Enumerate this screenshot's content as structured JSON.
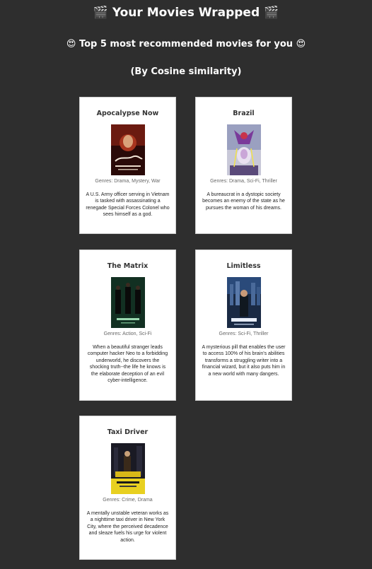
{
  "header": {
    "title": "🎬 Your Movies Wrapped 🎬",
    "subtitle": "😍 Top 5 most recommended movies for you 😍",
    "method": "(By Cosine similarity)"
  },
  "movies": [
    {
      "title": "Apocalypse Now",
      "genres": "Genres: Drama, Mystery, War",
      "description": "A U.S. Army officer serving in Vietnam is tasked with assassinating a renegade Special Forces Colonel who sees himself as a god."
    },
    {
      "title": "Brazil",
      "genres": "Genres: Drama, Sci-Fi, Thriller",
      "description": "A bureaucrat in a dystopic society becomes an enemy of the state as he pursues the woman of his dreams."
    },
    {
      "title": "The Matrix",
      "genres": "Genres: Action, Sci-Fi",
      "description": "When a beautiful stranger leads computer hacker Neo to a forbidding underworld, he discovers the shocking truth--the life he knows is the elaborate deception of an evil cyber-intelligence."
    },
    {
      "title": "Limitless",
      "genres": "Genres: Sci-Fi, Thriller",
      "description": "A mysterious pill that enables the user to access 100% of his brain's abilities transforms a struggling writer into a financial wizard, but it also puts him in a new world with many dangers."
    },
    {
      "title": "Taxi Driver",
      "genres": "Genres: Crime, Drama",
      "description": "A mentally unstable veteran works as a nighttime taxi driver in New York City, where the perceived decadence and sleaze fuels his urge for violent action."
    }
  ]
}
